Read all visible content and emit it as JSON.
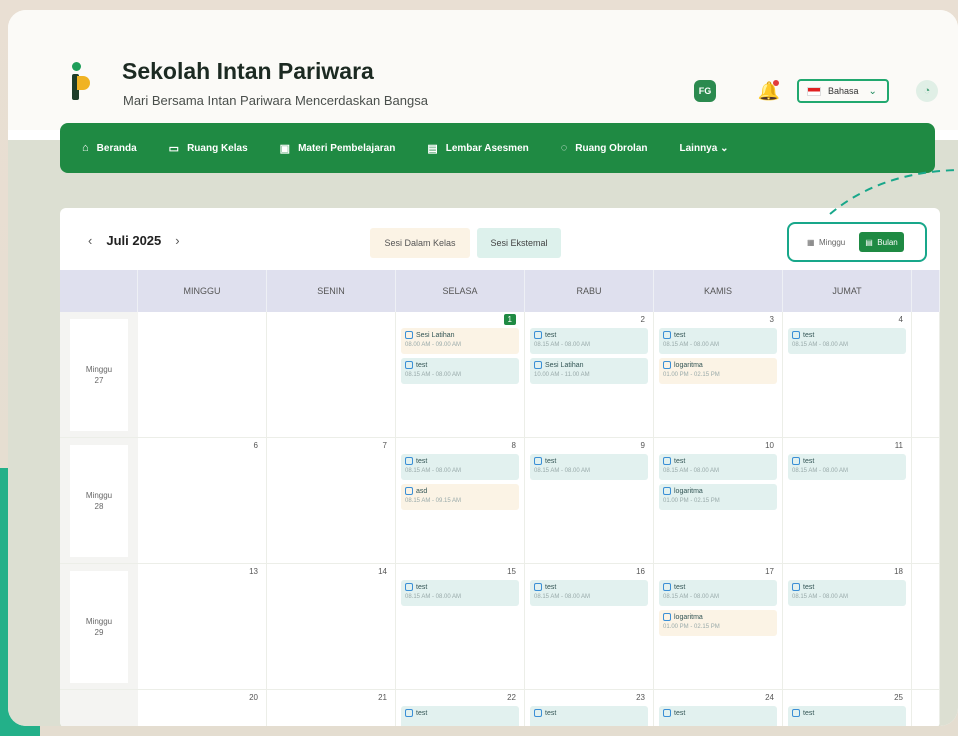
{
  "app": {
    "title": "Sekolah Intan Pariwara",
    "subtitle": "Mari Bersama Intan Pariwara Mencerdaskan Bangsa",
    "fg_badge": "FG",
    "language": "Bahasa"
  },
  "nav": {
    "items": [
      {
        "label": "Beranda",
        "icon": "⌂"
      },
      {
        "label": "Ruang Kelas",
        "icon": "▭"
      },
      {
        "label": "Materi Pembelajaran",
        "icon": "▣"
      },
      {
        "label": "Lembar Asesmen",
        "icon": "▤"
      },
      {
        "label": "Ruang Obrolan",
        "icon": "◌"
      },
      {
        "label": "Lainnya ⌄",
        "icon": ""
      }
    ]
  },
  "calendar": {
    "month": "Juli 2025",
    "segments": [
      "Sesi Dalam Kelas",
      "Sesi Ekstemal"
    ],
    "views": {
      "week": "Minggu",
      "month": "Bulan"
    },
    "headers": [
      "MINGGU",
      "SENIN",
      "SELASA",
      "RABU",
      "KAMIS",
      "JUMAT"
    ],
    "weeks": [
      {
        "label": "Minggu",
        "num": "27",
        "days": [
          {
            "num": "",
            "events": []
          },
          {
            "num": "",
            "events": []
          },
          {
            "num": "1",
            "today": true,
            "events": [
              {
                "title": "Sesi Latihan",
                "time": "08.00 AM - 09.00 AM",
                "color": "cream"
              },
              {
                "title": "test",
                "time": "08.15 AM - 08.00 AM",
                "color": "teal"
              }
            ]
          },
          {
            "num": "2",
            "events": [
              {
                "title": "test",
                "time": "08.15 AM - 08.00 AM",
                "color": "teal"
              },
              {
                "title": "Sesi Latihan",
                "time": "10.00 AM - 11.00 AM",
                "color": "teal"
              }
            ]
          },
          {
            "num": "3",
            "events": [
              {
                "title": "test",
                "time": "08.15 AM - 08.00 AM",
                "color": "teal"
              },
              {
                "title": "logaritma",
                "time": "01.00 PM - 02.15 PM",
                "color": "cream"
              }
            ]
          },
          {
            "num": "4",
            "events": [
              {
                "title": "test",
                "time": "08.15 AM - 08.00 AM",
                "color": "teal"
              }
            ]
          }
        ]
      },
      {
        "label": "Minggu",
        "num": "28",
        "days": [
          {
            "num": "6",
            "events": []
          },
          {
            "num": "7",
            "events": []
          },
          {
            "num": "8",
            "events": [
              {
                "title": "test",
                "time": "08.15 AM - 08.00 AM",
                "color": "teal"
              },
              {
                "title": "asd",
                "time": "08.15 AM - 09.15 AM",
                "color": "cream"
              }
            ]
          },
          {
            "num": "9",
            "events": [
              {
                "title": "test",
                "time": "08.15 AM - 08.00 AM",
                "color": "teal"
              }
            ]
          },
          {
            "num": "10",
            "events": [
              {
                "title": "test",
                "time": "08.15 AM - 08.00 AM",
                "color": "teal"
              },
              {
                "title": "logaritma",
                "time": "01.00 PM - 02.15 PM",
                "color": "teal"
              }
            ]
          },
          {
            "num": "11",
            "events": [
              {
                "title": "test",
                "time": "08.15 AM - 08.00 AM",
                "color": "teal"
              }
            ]
          }
        ]
      },
      {
        "label": "Minggu",
        "num": "29",
        "days": [
          {
            "num": "13",
            "events": []
          },
          {
            "num": "14",
            "events": []
          },
          {
            "num": "15",
            "events": [
              {
                "title": "test",
                "time": "08.15 AM - 08.00 AM",
                "color": "teal"
              }
            ]
          },
          {
            "num": "16",
            "events": [
              {
                "title": "test",
                "time": "08.15 AM - 08.00 AM",
                "color": "teal"
              }
            ]
          },
          {
            "num": "17",
            "events": [
              {
                "title": "test",
                "time": "08.15 AM - 08.00 AM",
                "color": "teal"
              },
              {
                "title": "logaritma",
                "time": "01.00 PM - 02.15 PM",
                "color": "cream"
              }
            ]
          },
          {
            "num": "18",
            "events": [
              {
                "title": "test",
                "time": "08.15 AM - 08.00 AM",
                "color": "teal"
              }
            ]
          }
        ]
      },
      {
        "label": "",
        "num": "",
        "days": [
          {
            "num": "20",
            "events": []
          },
          {
            "num": "21",
            "events": []
          },
          {
            "num": "22",
            "events": [
              {
                "title": "test",
                "time": "",
                "color": "teal"
              }
            ]
          },
          {
            "num": "23",
            "events": [
              {
                "title": "test",
                "time": "",
                "color": "teal"
              }
            ]
          },
          {
            "num": "24",
            "events": [
              {
                "title": "test",
                "time": "",
                "color": "teal"
              }
            ]
          },
          {
            "num": "25",
            "events": [
              {
                "title": "test",
                "time": "",
                "color": "teal"
              }
            ]
          }
        ]
      }
    ]
  }
}
